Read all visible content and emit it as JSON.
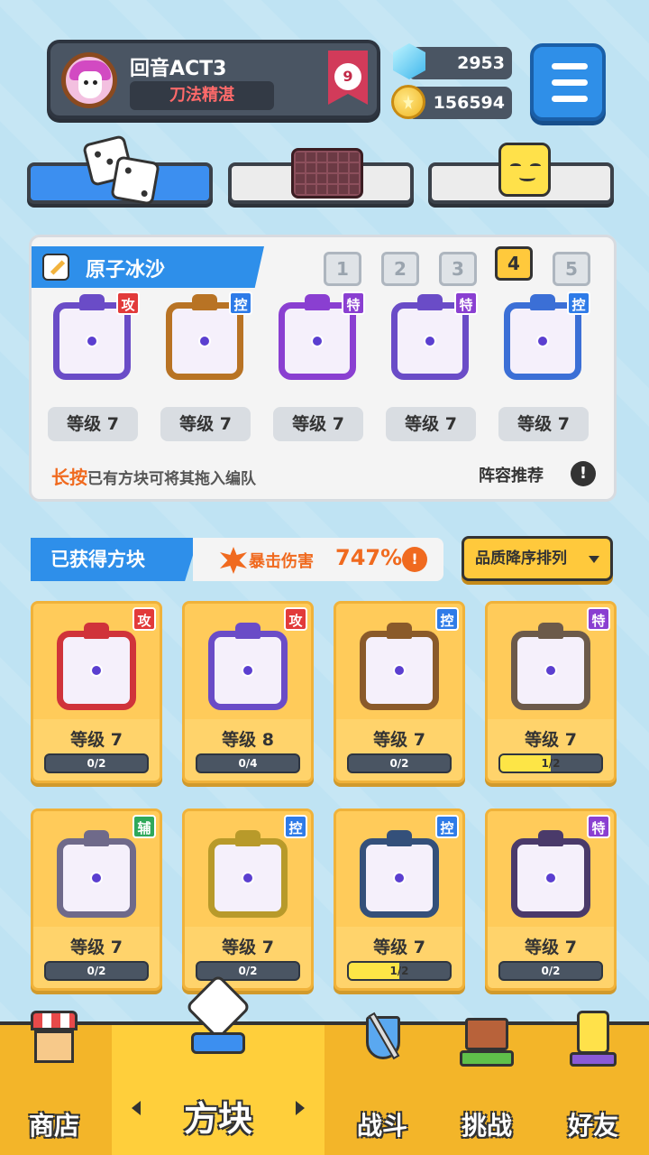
{
  "player": {
    "name": "回音ACT3",
    "title": "刀法精湛",
    "rank": "9"
  },
  "currency": {
    "gems": "2953",
    "coins": "156594"
  },
  "deck": {
    "name": "原子冰沙",
    "slots": [
      "1",
      "2",
      "3",
      "4",
      "5"
    ],
    "active_slot": "4",
    "blocks": [
      {
        "tag": "攻",
        "level": "等级 7",
        "color": "#6a4cc7"
      },
      {
        "tag": "控",
        "level": "等级 7",
        "color": "#b87324"
      },
      {
        "tag": "特",
        "level": "等级 7",
        "color": "#8a3fd1"
      },
      {
        "tag": "特",
        "level": "等级 7",
        "color": "#6a4cc7"
      },
      {
        "tag": "控",
        "level": "等级 7",
        "color": "#3b6fd6"
      }
    ],
    "hint_highlight": "长按",
    "hint_text": "已有方块可将其拖入编队",
    "recommend": "阵容推荐",
    "recommend_icon": "!"
  },
  "collection": {
    "header": "已获得方块",
    "crit_label": "暴击伤害",
    "crit_value": "747%",
    "crit_info": "!",
    "sort_label": "品质降序排列",
    "cards": [
      {
        "tag": "攻",
        "level": "等级 7",
        "progress": "0/2",
        "fill": 0,
        "color": "#d0333a"
      },
      {
        "tag": "攻",
        "level": "等级 8",
        "progress": "0/4",
        "fill": 0,
        "color": "#6a4cc7"
      },
      {
        "tag": "控",
        "level": "等级 7",
        "progress": "0/2",
        "fill": 0,
        "color": "#8a5a2a"
      },
      {
        "tag": "特",
        "level": "等级 7",
        "progress": "1/2",
        "fill": 0.5,
        "color": "#6c5a4a"
      },
      {
        "tag": "辅",
        "level": "等级 7",
        "progress": "0/2",
        "fill": 0,
        "color": "#6f6a8a"
      },
      {
        "tag": "控",
        "level": "等级 7",
        "progress": "0/2",
        "fill": 0,
        "color": "#b89a2a"
      },
      {
        "tag": "控",
        "level": "等级 7",
        "progress": "1/2",
        "fill": 0.5,
        "color": "#34507a"
      },
      {
        "tag": "特",
        "level": "等级 7",
        "progress": "0/2",
        "fill": 0,
        "color": "#4a3a6a"
      }
    ]
  },
  "nav": {
    "shop": "商店",
    "blocks": "方块",
    "battle": "战斗",
    "challenge": "挑战",
    "friends": "好友"
  }
}
